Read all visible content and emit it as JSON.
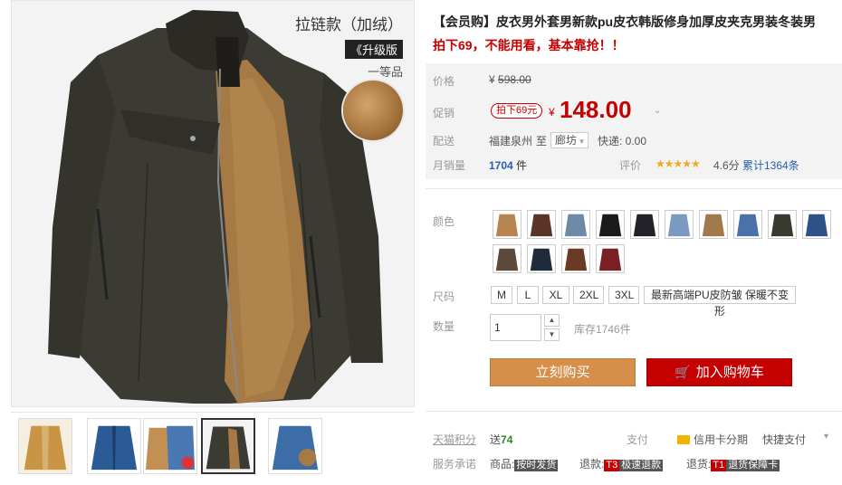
{
  "gallery": {
    "promo_title": "拉链款（加绒）",
    "promo_badge": "《升级版",
    "promo_grade": "一等品"
  },
  "product": {
    "title": "【会员购】皮衣男外套男新款pu皮衣韩版修身加厚皮夹克男装冬装男",
    "subtitle": "拍下69，不能用看，基本靠抢！！"
  },
  "price": {
    "label": "价格",
    "currency": "¥",
    "original": "598.00",
    "promo_label": "促销",
    "promo_tag": "拍下69元",
    "promo_price": "148.00"
  },
  "delivery": {
    "label": "配送",
    "from": "福建泉州",
    "to_label": "至",
    "destination": "廊坊",
    "shipping": "快递: 0.00"
  },
  "sales": {
    "label": "月销量",
    "count": "1704",
    "unit": "件",
    "rating_label": "评价",
    "rating_stars": "★★★★★",
    "rating": "4.6分",
    "reviews": "累计1364条"
  },
  "options": {
    "color_label": "颜色",
    "colors_count": 14,
    "size_label": "尺码",
    "sizes": [
      "M",
      "L",
      "XL",
      "2XL",
      "3XL"
    ],
    "size_note": "最新高端PU皮防皱 保暖不变形",
    "qty_label": "数量",
    "qty_value": "1",
    "stock": "库存1746件"
  },
  "actions": {
    "buy_label": "立刻购买",
    "cart_label": "加入购物车"
  },
  "points": {
    "label": "天猫积分",
    "send_label": "送",
    "value": "74",
    "pay_label": "支付",
    "credit_label": "信用卡分期",
    "quick_pay": "快捷支付"
  },
  "service": {
    "label": "服务承诺",
    "goods_label": "商品:",
    "goods_badge": "按时发货",
    "refund_label": "退款:",
    "refund_badge_num": "T3",
    "refund_badge": "极速退款",
    "return_label": "退货:",
    "return_badge_num": "T1",
    "return_badge": "退货保障卡"
  },
  "colors": {
    "accent": "#c40000",
    "buy_button": "#d68f4a"
  }
}
